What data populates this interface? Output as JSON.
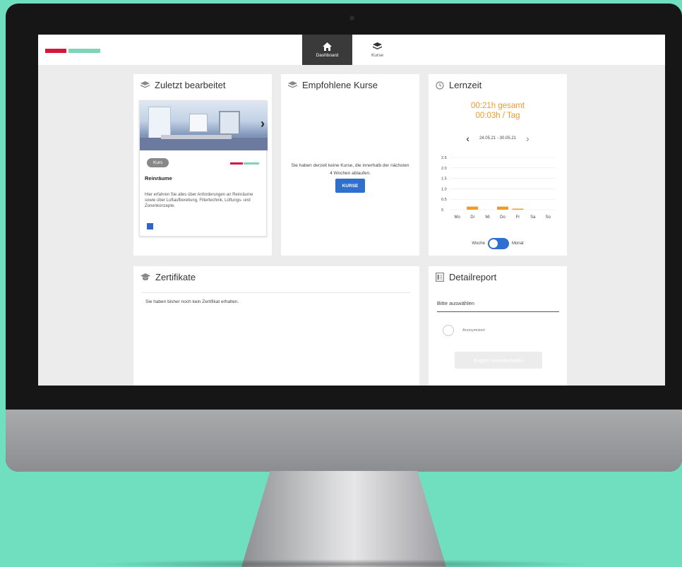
{
  "nav": {
    "dashboard_label": "Dashboard",
    "kurse_label": "Kurse"
  },
  "recent": {
    "title": "Zuletzt bearbeitet",
    "tag": "Kurs",
    "course_name": "Reinräume",
    "course_desc": "Hier erfahren Sie alles über Anforderungen an Reinräume sowie über Luftaufbereitung, Filtertechnik, Lüftungs- und Zonenkonzepte."
  },
  "recommended": {
    "title": "Empfohlene Kurse",
    "empty_text": "Sie haben derzeit keine Kurse, die innerhalb der nächsten 4 Wochen ablaufen.",
    "button": "KURSE"
  },
  "lernzeit": {
    "title": "Lernzeit",
    "total": "00:21h gesamt",
    "per_day": "00:03h / Tag",
    "range": "24.05.21 - 30.05.21",
    "toggle_left": "Woche",
    "toggle_right": "Monat"
  },
  "chart_data": {
    "type": "bar",
    "categories": [
      "Mo",
      "Di",
      "Mi",
      "Do",
      "Fr",
      "Sa",
      "So"
    ],
    "values": [
      0,
      0.15,
      0,
      0.15,
      0.05,
      0,
      0
    ],
    "ylim": [
      0,
      2.5
    ],
    "yticks": [
      "2.5",
      "2.0",
      "1.5",
      "1.0",
      "0.5",
      "0"
    ],
    "color": "#f29b2a",
    "grid": true
  },
  "certs": {
    "title": "Zertifikate",
    "text": "Sie haben bisher noch kein Zertifikat erhalten."
  },
  "report": {
    "title": "Detailreport",
    "select_placeholder": "Bitte auswählen",
    "radio_label": "Anonymisiert",
    "button": "Report herunterladen"
  },
  "colors": {
    "accent_blue": "#2f6fcf",
    "accent_orange": "#f29b2a",
    "brand_red": "#d6173d",
    "brand_mint": "#7fd3b6",
    "background": "#6fdfc0"
  }
}
